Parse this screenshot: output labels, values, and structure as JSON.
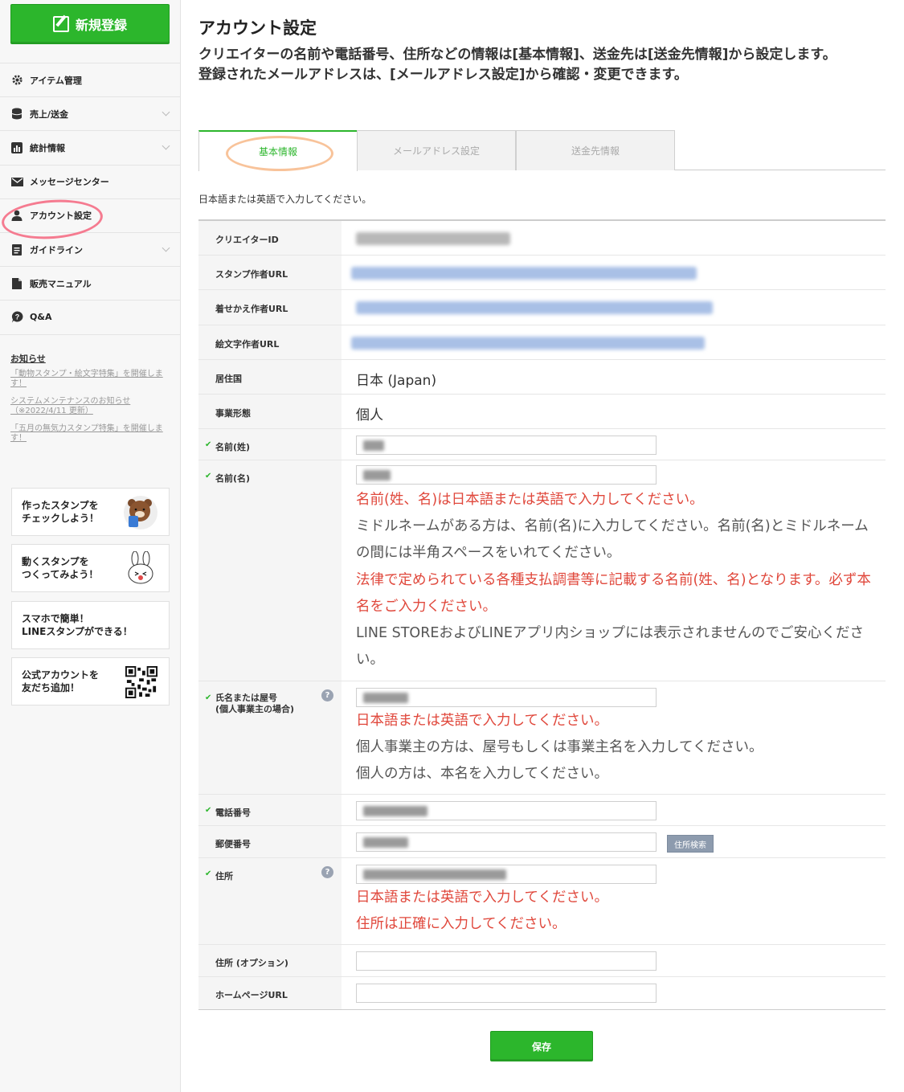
{
  "sidebar": {
    "new_button": "新規登録",
    "menu": [
      {
        "label": "アイテム管理",
        "icon": "gear-icon",
        "chevron": false
      },
      {
        "label": "売上/送金",
        "icon": "coins-icon",
        "chevron": true
      },
      {
        "label": "統計情報",
        "icon": "chart-icon",
        "chevron": true
      },
      {
        "label": "メッセージセンター",
        "icon": "mail-icon",
        "chevron": false
      },
      {
        "label": "アカウント設定",
        "icon": "user-icon",
        "chevron": false
      },
      {
        "label": "ガイドライン",
        "icon": "document-icon",
        "chevron": true
      },
      {
        "label": "販売マニュアル",
        "icon": "file-icon",
        "chevron": false
      },
      {
        "label": "Q&A",
        "icon": "question-icon",
        "chevron": false
      }
    ],
    "news_title": "お知らせ",
    "news": [
      "「動物スタンプ・絵文字特集」を開催します！",
      "システムメンテナンスのお知らせ（※2022/4/11 更新）",
      "「五月の無気力スタンプ特集」を開催します！"
    ],
    "banners": [
      {
        "line1": "作ったスタンプを",
        "line2": "チェックしよう！"
      },
      {
        "line1": "動くスタンプを",
        "line2": "つくってみよう！"
      },
      {
        "line1": "スマホで簡単！",
        "line2": "LINEスタンプができる！"
      },
      {
        "line1": "公式アカウントを",
        "line2": "友だち追加！"
      }
    ]
  },
  "main": {
    "title": "アカウント設定",
    "lead": "クリエイターの名前や電話番号、住所などの情報は[基本情報]、送金先は[送金先情報]から設定します。\n登録されたメールアドレスは、[メールアドレス設定]から確認・変更できます。",
    "tabs": [
      "基本情報",
      "メールアドレス設定",
      "送金先情報"
    ],
    "note": "日本語または英語で入力してください。",
    "labels": {
      "creator_id": "クリエイターID",
      "stamp_url": "スタンプ作者URL",
      "theme_url": "着せかえ作者URL",
      "emoji_url": "絵文字作者URL",
      "country": "居住国",
      "business": "事業形態",
      "last_name": "名前(姓)",
      "first_name": "名前(名)",
      "trade_name_1": "氏名または屋号",
      "trade_name_2": "(個人事業主の場合)",
      "phone": "電話番号",
      "zip": "郵便番号",
      "address": "住所",
      "address_opt": "住所 (オプション)",
      "homepage": "ホームページURL"
    },
    "values": {
      "country": "日本 (Japan)",
      "business": "個人"
    },
    "messages": {
      "name_1": "名前(姓、名)は日本語または英語で入力してください。",
      "name_2": "ミドルネームがある方は、名前(名)に入力してください。名前(名)とミドルネームの間には半角スペースをいれてください。",
      "name_3": "法律で定められている各種支払調書等に記載する名前(姓、名)となります。必ず本名をご入力ください。",
      "name_4": "LINE STOREおよびLINEアプリ内ショップには表示されませんのでご安心ください。",
      "trade_1": "日本語または英語で入力してください。",
      "trade_2": "個人事業主の方は、屋号もしくは事業主名を入力してください。",
      "trade_3": "個人の方は、本名を入力してください。",
      "addr_1": "日本語または英語で入力してください。",
      "addr_2": "住所は正確に入力してください。"
    },
    "zip_button": "住所検索",
    "save_button": "保存",
    "help_glyph": "?",
    "check_glyph": "✔"
  },
  "colors": {
    "brand_green": "#2cb62c",
    "error_red": "#e0483c",
    "annotation_pink": "#f57b90",
    "annotation_orange": "#f8c39a"
  }
}
